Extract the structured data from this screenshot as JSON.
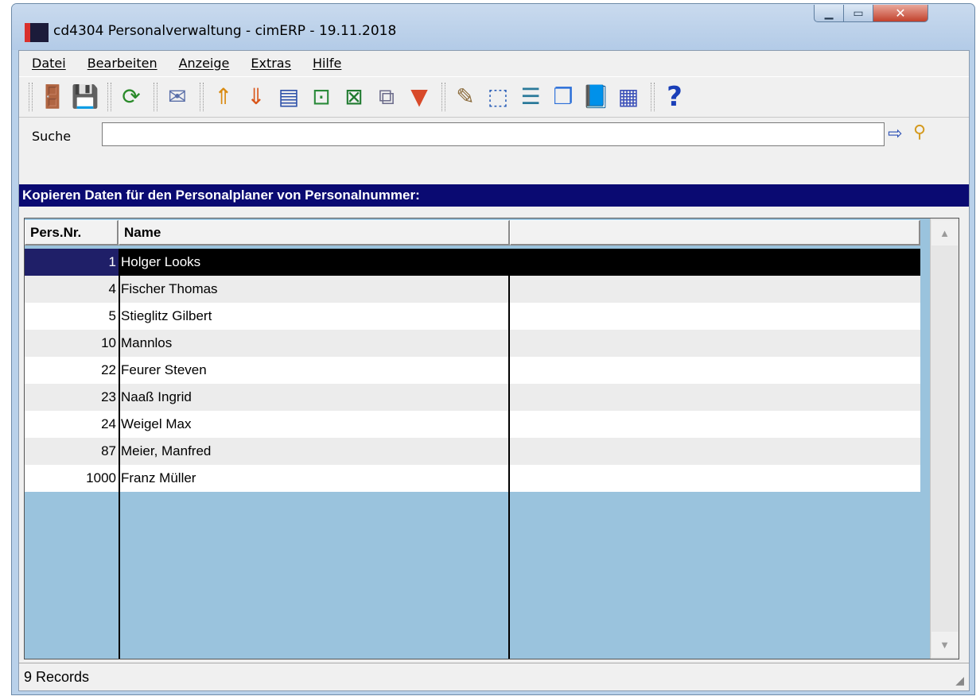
{
  "window": {
    "title": "cd4304 Personalverwaltung - cimERP - 19.11.2018"
  },
  "menu": [
    {
      "label": "Datei"
    },
    {
      "label": "Bearbeiten"
    },
    {
      "label": "Anzeige"
    },
    {
      "label": "Extras"
    },
    {
      "label": "Hilfe"
    }
  ],
  "toolbar": {
    "icons": [
      "exit-door-icon",
      "save-icon",
      "refresh-icon",
      "mail-icon",
      "sort-ascending-icon",
      "sort-descending-icon",
      "number-format-icon",
      "export-icon",
      "excel-export-icon",
      "copy-icon",
      "filter-icon",
      "edit-record-icon",
      "select-area-icon",
      "list-transfer-icon",
      "windows-icon",
      "book-icon",
      "calendar-grid-icon",
      "help-icon"
    ]
  },
  "search": {
    "label": "Suche",
    "value": ""
  },
  "heading": "Kopieren Daten für den Personalplaner von Personalnummer:",
  "table": {
    "columns": [
      "Pers.Nr.",
      "Name",
      ""
    ],
    "rows": [
      {
        "nr": "1",
        "name": "Holger Looks"
      },
      {
        "nr": "4",
        "name": "Fischer Thomas"
      },
      {
        "nr": "5",
        "name": "Stieglitz Gilbert"
      },
      {
        "nr": "10",
        "name": "Mannlos"
      },
      {
        "nr": "22",
        "name": "Feurer Steven"
      },
      {
        "nr": "23",
        "name": "Naaß Ingrid"
      },
      {
        "nr": "24",
        "name": "Weigel Max"
      },
      {
        "nr": "87",
        "name": "Meier, Manfred"
      },
      {
        "nr": "1000",
        "name": "Franz Müller"
      }
    ],
    "selected_index": 0
  },
  "status": {
    "text": "9 Records"
  },
  "colors": {
    "heading_bg": "#0a0a72",
    "grid_bg": "#9ac3dd",
    "selection_bg": "#000000"
  }
}
